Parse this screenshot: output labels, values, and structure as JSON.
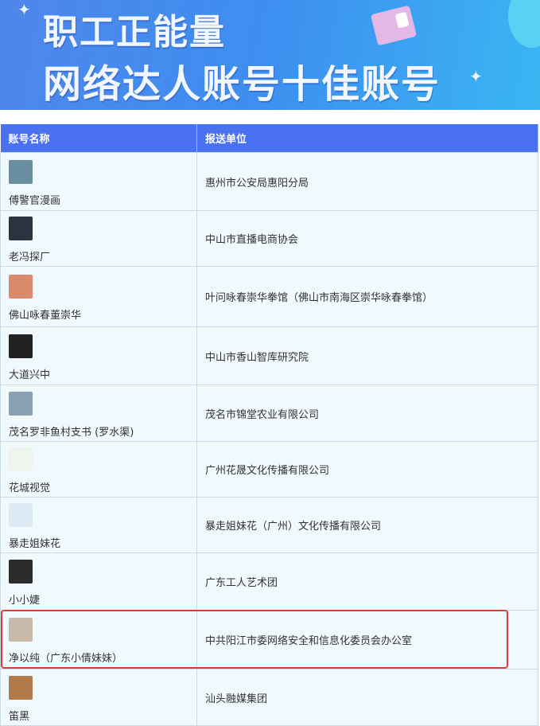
{
  "banner": {
    "title_line1": "职工正能量",
    "title_line2": "网络达人账号十佳账号"
  },
  "table": {
    "headers": [
      "账号名称",
      "报送单位"
    ],
    "rows": [
      {
        "name": "傅警官漫画",
        "unit": "惠州市公安局惠阳分局",
        "avatar_color": "#6a8fa0"
      },
      {
        "name": "老冯探厂",
        "unit": "中山市直播电商协会",
        "avatar_color": "#2a3440"
      },
      {
        "name": "佛山咏春董崇华",
        "unit": "叶问咏春崇华拳馆（佛山市南海区崇华咏春拳馆）",
        "avatar_color": "#d98a6a"
      },
      {
        "name": "大道兴中",
        "unit": "中山市香山智库研究院",
        "avatar_color": "#222"
      },
      {
        "name": "茂名罗非鱼村支书 (罗水渠)",
        "unit": "茂名市锦堂农业有限公司",
        "avatar_color": "#8aa0b5"
      },
      {
        "name": "花城视觉",
        "unit": "广州花晟文化传播有限公司",
        "avatar_color": "#eef4ee"
      },
      {
        "name": "暴走姐妹花",
        "unit": "暴走姐妹花（广州）文化传播有限公司",
        "avatar_color": "#dceaf5"
      },
      {
        "name": "小小婕",
        "unit": "广东工人艺术团",
        "avatar_color": "#2c2c2c"
      },
      {
        "name": "净以纯（广东小倩妹妹）",
        "unit": "中共阳江市委网络安全和信息化委员会办公室",
        "avatar_color": "#c8b8a8"
      },
      {
        "name": "笛黑",
        "unit": "汕头融媒集团",
        "avatar_color": "#b07a4a"
      }
    ]
  }
}
